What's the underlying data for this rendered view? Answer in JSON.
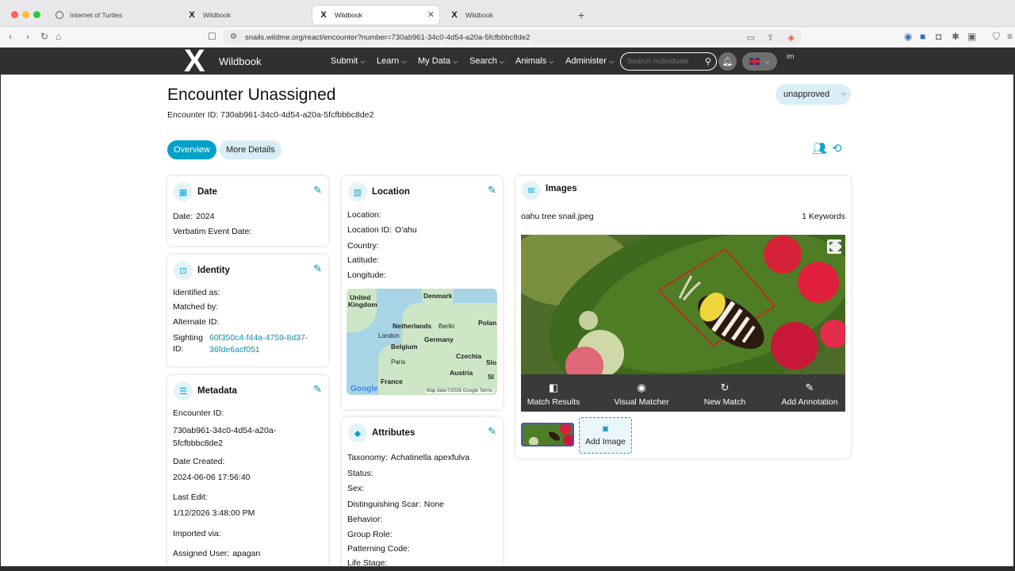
{
  "browser": {
    "tabs": [
      {
        "title": "Internet of Turtles",
        "icon": "globe-icon"
      },
      {
        "title": "Wildbook",
        "icon": "wildbook-x-icon"
      },
      {
        "title": "Wildbook",
        "icon": "wildbook-x-icon"
      },
      {
        "title": "Wildbook",
        "icon": "wildbook-x-icon"
      }
    ],
    "url": "snails.wildme.org/react/encounter?number=730ab961-34c0-4d54-a20a-5fcfbbbc8de2"
  },
  "nav": {
    "brand": "Wildbook",
    "items": [
      "Submit",
      "Learn",
      "My Data",
      "Search",
      "Animals",
      "Administer"
    ],
    "search_placeholder": "Search Individuals",
    "avatar_alt": "im"
  },
  "header": {
    "title": "Encounter Unassigned",
    "encounter_id_line": "Encounter ID: 730ab961-34c0-4d54-a20a-5fcfbbbc8de2",
    "status": "unapproved",
    "tabs": [
      "Overview",
      "More Details"
    ]
  },
  "date_card": {
    "title": "Date",
    "date_label": "Date:",
    "date_value": "2024",
    "verbatim_label": "Verbatim Event Date:"
  },
  "identity_card": {
    "title": "Identity",
    "identified_as": "Identified as:",
    "matched_by": "Matched by:",
    "alternate_id": "Alternate ID:",
    "sighting_label": "Sighting",
    "sighting_label2": "ID:",
    "sighting_line1": "60f350c4-f44a-4759-8d37-",
    "sighting_line2": "36fde6acf051"
  },
  "metadata_card": {
    "title": "Metadata",
    "encounter_id_label": "Encounter ID:",
    "encounter_id_line1": "730ab961-34c0-4d54-a20a-",
    "encounter_id_line2": "5fcfbbbc8de2",
    "date_created_label": "Date Created:",
    "date_created": "2024-06-06 17:56:40",
    "last_edit_label": "Last Edit:",
    "last_edit": "1/12/2026 3:48:00 PM",
    "imported_label": "Imported via:",
    "assigned_label": "Assigned User:",
    "assigned_user": "apagan"
  },
  "location_card": {
    "title": "Location",
    "location_label": "Location:",
    "location_id_label": "Location ID:",
    "location_id": "O'ahu",
    "country_label": "Country:",
    "latitude_label": "Latitude:",
    "longitude_label": "Longitude:",
    "map": {
      "labels": [
        "United",
        "Kingdom",
        "Denmark",
        "Netherlands",
        "Berlin",
        "Polan",
        "London",
        "Belgium",
        "Germany",
        "Paris",
        "Czechia",
        "Slo",
        "Austria",
        "France",
        "Sl"
      ],
      "google": "Google",
      "attribution": "Map data ©2026 Google  Terms"
    }
  },
  "attributes_card": {
    "title": "Attributes",
    "taxonomy_label": "Taxonomy:",
    "taxonomy": "Achatinella apexfulva",
    "status_label": "Status:",
    "sex_label": "Sex:",
    "scar_label": "Distinguishing Scar:",
    "scar": "None",
    "behavior_label": "Behavior:",
    "group_role_label": "Group Role:",
    "patterning_label": "Patterning Code:",
    "life_stage_label": "Life Stage:"
  },
  "images_card": {
    "title": "Images",
    "filename": "oahu tree snail.jpeg",
    "keywords": "1 Keywords",
    "actions": [
      {
        "label": "Match Results",
        "icon": "match-results-icon"
      },
      {
        "label": "Visual Matcher",
        "icon": "eye-icon"
      },
      {
        "label": "New Match",
        "icon": "refresh-icon"
      },
      {
        "label": "Add Annotation",
        "icon": "annotate-icon"
      }
    ],
    "add_image": "Add Image"
  },
  "colors": {
    "accent": "#00a2c9",
    "nav_bg": "#303030",
    "pill_bg": "#d8eef7"
  }
}
